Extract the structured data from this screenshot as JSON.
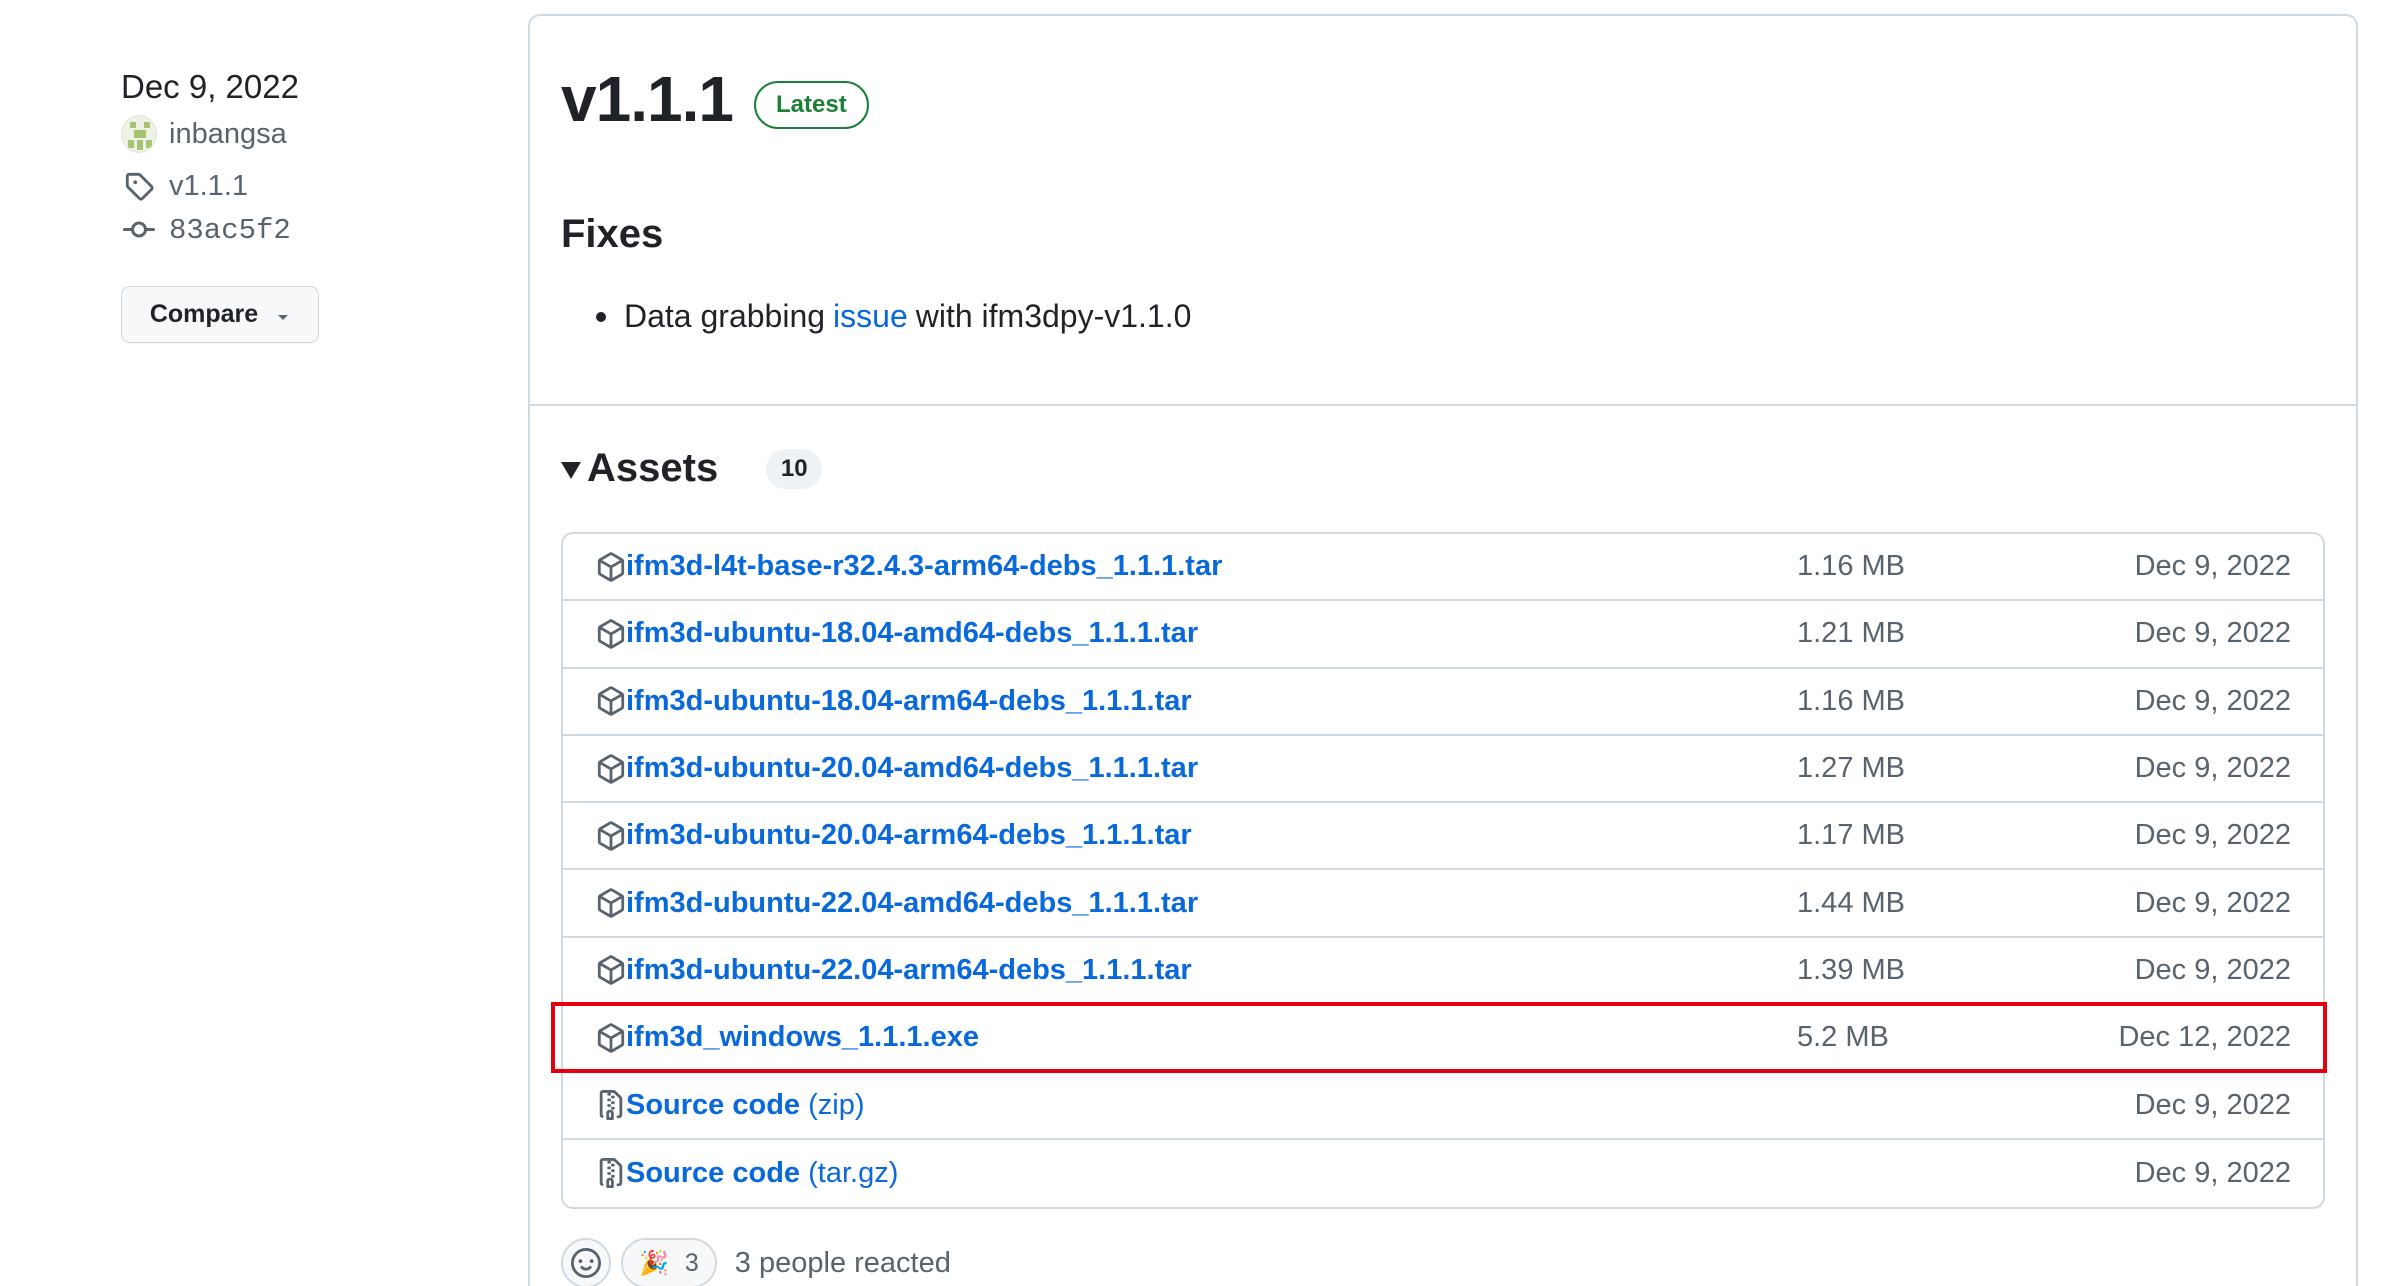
{
  "meta": {
    "date": "Dec 9, 2022",
    "author": "inbangsa",
    "tag": "v1.1.1",
    "commit": "83ac5f2",
    "compare_label": "Compare"
  },
  "release": {
    "version": "v1.1.1",
    "badge": "Latest",
    "section_title": "Fixes",
    "bullet_before": "Data grabbing",
    "bullet_link": "issue",
    "bullet_after": "with ifm3dpy-v1.1.0"
  },
  "assets": {
    "title": "Assets",
    "count": "10",
    "items": [
      {
        "name": "ifm3d-l4t-base-r32.4.3-arm64-debs_1.1.1.tar",
        "suffix": "",
        "size": "1.16 MB",
        "date": "Dec 9, 2022",
        "icon": "package-icon"
      },
      {
        "name": "ifm3d-ubuntu-18.04-amd64-debs_1.1.1.tar",
        "suffix": "",
        "size": "1.21 MB",
        "date": "Dec 9, 2022",
        "icon": "package-icon"
      },
      {
        "name": "ifm3d-ubuntu-18.04-arm64-debs_1.1.1.tar",
        "suffix": "",
        "size": "1.16 MB",
        "date": "Dec 9, 2022",
        "icon": "package-icon"
      },
      {
        "name": "ifm3d-ubuntu-20.04-amd64-debs_1.1.1.tar",
        "suffix": "",
        "size": "1.27 MB",
        "date": "Dec 9, 2022",
        "icon": "package-icon"
      },
      {
        "name": "ifm3d-ubuntu-20.04-arm64-debs_1.1.1.tar",
        "suffix": "",
        "size": "1.17 MB",
        "date": "Dec 9, 2022",
        "icon": "package-icon"
      },
      {
        "name": "ifm3d-ubuntu-22.04-amd64-debs_1.1.1.tar",
        "suffix": "",
        "size": "1.44 MB",
        "date": "Dec 9, 2022",
        "icon": "package-icon"
      },
      {
        "name": "ifm3d-ubuntu-22.04-arm64-debs_1.1.1.tar",
        "suffix": "",
        "size": "1.39 MB",
        "date": "Dec 9, 2022",
        "icon": "package-icon"
      },
      {
        "name": "ifm3d_windows_1.1.1.exe",
        "suffix": "",
        "size": "5.2 MB",
        "date": "Dec 12, 2022",
        "icon": "package-icon"
      },
      {
        "name": "Source code",
        "suffix": " (zip)",
        "size": "",
        "date": "Dec 9, 2022",
        "icon": "file-zip-icon"
      },
      {
        "name": "Source code",
        "suffix": " (tar.gz)",
        "size": "",
        "date": "Dec 9, 2022",
        "icon": "file-zip-icon"
      }
    ]
  },
  "highlight_color": "#e3000f",
  "reactions": {
    "emoji": "🎉",
    "count": "3",
    "summary": "3 people reacted"
  }
}
